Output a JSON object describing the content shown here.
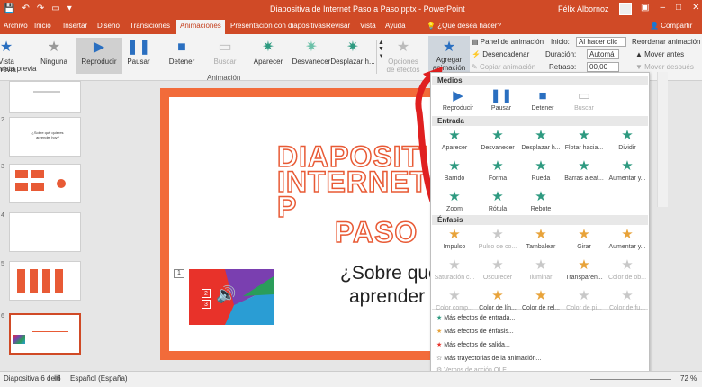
{
  "titlebar": {
    "doc_title": "Diapositiva de Internet Paso a Paso.pptx - PowerPoint",
    "user": "Félix Albornoz"
  },
  "tabs": [
    {
      "label": "Archivo"
    },
    {
      "label": "Inicio"
    },
    {
      "label": "Insertar"
    },
    {
      "label": "Diseño"
    },
    {
      "label": "Transiciones"
    },
    {
      "label": "Animaciones"
    },
    {
      "label": "Presentación con diapositivas"
    },
    {
      "label": "Revisar"
    },
    {
      "label": "Vista"
    },
    {
      "label": "Ayuda"
    },
    {
      "label": "¿Qué desea hacer?"
    },
    {
      "label": "Compartir"
    }
  ],
  "ribbon": {
    "vista_previa": "Vista previa",
    "vista_previa2": "vista previa",
    "gallery": [
      "Ninguna",
      "Reproducir",
      "Pausar",
      "Detener",
      "Buscar",
      "Aparecer",
      "Desvanecer",
      "Desplazar h..."
    ],
    "opciones_efectos": "Opciones de efectos",
    "group_animacion": "Animación",
    "agregar": "Agregar animación",
    "panel": "Panel de animación",
    "desencadenar": "Desencadenar",
    "copiar": "Copiar animación",
    "inicio_label": "Inicio:",
    "inicio_value": "Al hacer clic",
    "duracion_label": "Duración:",
    "duracion_value": "Automá",
    "retraso_label": "Retraso:",
    "retraso_value": "00,00",
    "reordenar": "Reordenar animación",
    "mover_antes": "Mover antes",
    "mover_despues": "Mover después"
  },
  "slides": {
    "nums": [
      "1",
      "2",
      "3",
      "4",
      "5",
      "6"
    ],
    "thumb2_text": "¿Sobre qué quieres aprender hoy?"
  },
  "slide": {
    "title_line1": "DIAPOSITI",
    "title_line2": "INTERNET P",
    "title_line3": "PASO",
    "subtitle_line1": "¿Sobre qué",
    "subtitle_line2": "aprender",
    "media_number": "1",
    "media_badge_1": "2",
    "media_badge_2": "3"
  },
  "status": {
    "slide_info": "Diapositiva 6 de 6",
    "language": "Español (España)",
    "zoom": "72 %"
  },
  "dropdown": {
    "sec_medios": "Medios",
    "medios": [
      {
        "label": "Reproducir",
        "disabled": false
      },
      {
        "label": "Pausar",
        "disabled": false
      },
      {
        "label": "Detener",
        "disabled": false
      },
      {
        "label": "Buscar",
        "disabled": true
      }
    ],
    "sec_entrada": "Entrada",
    "entrada": [
      "Aparecer",
      "Desvanecer",
      "Desplazar h...",
      "Flotar hacia...",
      "Dividir",
      "Barrido",
      "Forma",
      "Rueda",
      "Barras aleat...",
      "Aumentar y...",
      "Zoom",
      "Rótula",
      "Rebote"
    ],
    "sec_enfasis": "Énfasis",
    "enfasis": [
      {
        "label": "Impulso",
        "disabled": false
      },
      {
        "label": "Pulso de co...",
        "disabled": true
      },
      {
        "label": "Tambalear",
        "disabled": false
      },
      {
        "label": "Girar",
        "disabled": false
      },
      {
        "label": "Aumentar y...",
        "disabled": false
      },
      {
        "label": "Saturación c...",
        "disabled": true
      },
      {
        "label": "Oscurecer",
        "disabled": true
      },
      {
        "label": "Iluminar",
        "disabled": true
      },
      {
        "label": "Transparen...",
        "disabled": false
      },
      {
        "label": "Color de ob...",
        "disabled": true
      },
      {
        "label": "Color comp...",
        "disabled": true
      },
      {
        "label": "Color de lín...",
        "disabled": false
      },
      {
        "label": "Color de rel...",
        "disabled": false
      },
      {
        "label": "Color de pi...",
        "disabled": true
      },
      {
        "label": "Color de fu...",
        "disabled": true
      }
    ],
    "more": [
      {
        "label": "Más efectos de entrada...",
        "disabled": false
      },
      {
        "label": "Más efectos de énfasis...",
        "disabled": false
      },
      {
        "label": "Más efectos de salida...",
        "disabled": false
      },
      {
        "label": "Más trayectorias de la animación...",
        "disabled": false
      },
      {
        "label": "Verbos de acción OLE...",
        "disabled": true
      }
    ]
  },
  "colors": {
    "accent": "#d04a26",
    "slide_border": "#f26b3a",
    "entrance_star": "#2e9a80",
    "emphasis_star": "#e8a33a",
    "media_icon": "#2a6fc0",
    "arrow": "#e02020"
  }
}
